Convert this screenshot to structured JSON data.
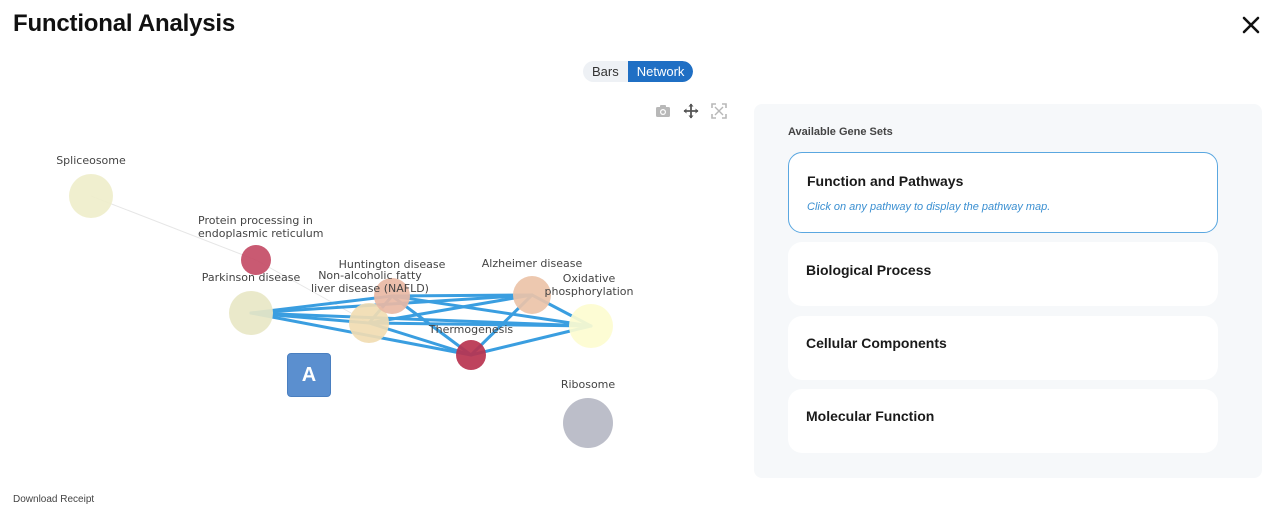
{
  "header": {
    "title": "Functional Analysis",
    "close_icon": "close-icon"
  },
  "view_toggle": {
    "options": [
      "Bars",
      "Network"
    ],
    "selected": "Network"
  },
  "toolbar": {
    "icons": [
      "camera-icon",
      "pan-icon",
      "autoscale-icon"
    ]
  },
  "network": {
    "nodes": [
      {
        "id": "spliceosome",
        "label_lines": [
          "Spliceosome"
        ],
        "color": "#efeecb"
      },
      {
        "id": "protein",
        "label_lines": [
          "Protein processing in",
          "endoplasmic reticulum"
        ],
        "color": "#c44c66"
      },
      {
        "id": "parkinson",
        "label_lines": [
          "Parkinson disease"
        ],
        "color": "#e8e7c5"
      },
      {
        "id": "nafld",
        "label_lines": [
          "Non-alcoholic fatty",
          "liver disease (NAFLD)"
        ],
        "color": "#f1dcb2"
      },
      {
        "id": "huntington",
        "label_lines": [
          "Huntington disease"
        ],
        "color": "#e9b9a4"
      },
      {
        "id": "alzheimer",
        "label_lines": [
          "Alzheimer disease"
        ],
        "color": "#ecc3a8"
      },
      {
        "id": "oxidative",
        "label_lines": [
          "Oxidative",
          "phosphorylation"
        ],
        "color": "#fdfcd0"
      },
      {
        "id": "thermogenesis",
        "label_lines": [
          "Thermogenesis"
        ],
        "color": "#b8334f"
      },
      {
        "id": "ribosome",
        "label_lines": [
          "Ribosome"
        ],
        "color": "#b6b8c4"
      }
    ],
    "edges": [
      [
        "spliceosome",
        "protein"
      ],
      [
        "protein",
        "nafld"
      ],
      [
        "parkinson",
        "huntington"
      ],
      [
        "parkinson",
        "nafld"
      ],
      [
        "parkinson",
        "alzheimer"
      ],
      [
        "parkinson",
        "oxidative"
      ],
      [
        "parkinson",
        "thermogenesis"
      ],
      [
        "huntington",
        "alzheimer"
      ],
      [
        "huntington",
        "oxidative"
      ],
      [
        "huntington",
        "thermogenesis"
      ],
      [
        "huntington",
        "nafld"
      ],
      [
        "nafld",
        "alzheimer"
      ],
      [
        "nafld",
        "oxidative"
      ],
      [
        "nafld",
        "thermogenesis"
      ],
      [
        "alzheimer",
        "oxidative"
      ],
      [
        "alzheimer",
        "thermogenesis"
      ],
      [
        "oxidative",
        "thermogenesis"
      ]
    ],
    "edge_color": "#3a9ee0"
  },
  "annotation": {
    "label": "A"
  },
  "footer": {
    "download_label": "Download Receipt"
  },
  "side_panel": {
    "heading": "Available Gene Sets",
    "cards": [
      {
        "title": "Function and Pathways",
        "hint": "Click on any pathway to display the pathway map.",
        "selected": true
      },
      {
        "title": "Biological Process",
        "selected": false
      },
      {
        "title": "Cellular Components",
        "selected": false
      },
      {
        "title": "Molecular Function",
        "selected": false
      }
    ]
  }
}
